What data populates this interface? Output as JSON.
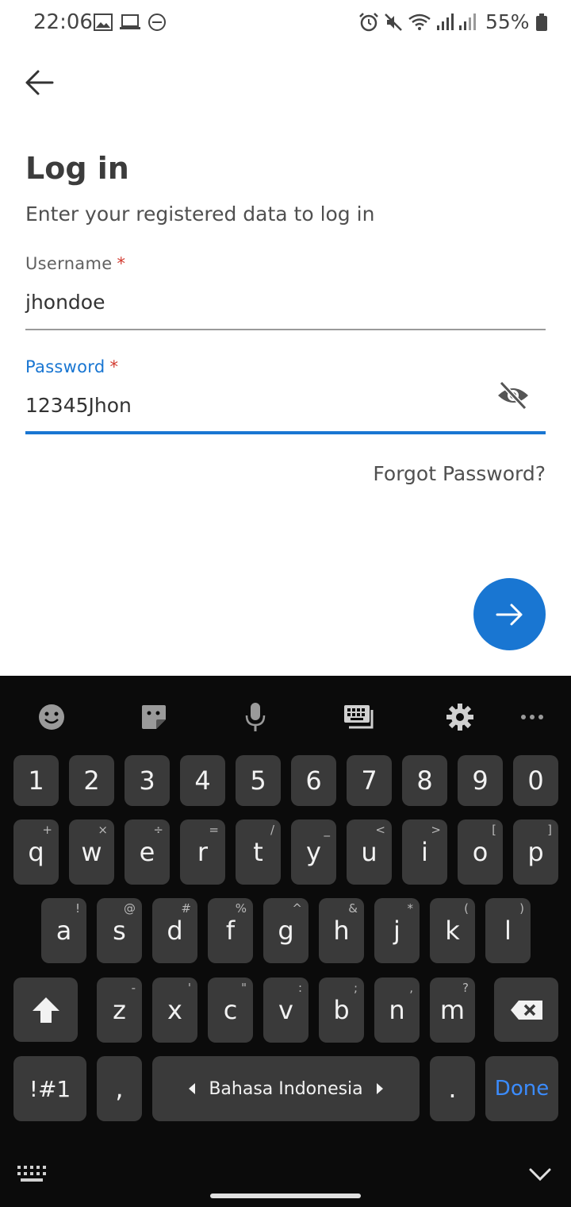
{
  "status": {
    "time": "22:06",
    "battery": "55%"
  },
  "login": {
    "title": "Log in",
    "subtitle": "Enter your registered data to log in",
    "username_label": "Username",
    "username_value": "jhondoe",
    "password_label": "Password",
    "password_value": "12345Jhon",
    "required_mark": "*",
    "forgot": "Forgot Password?"
  },
  "keyboard": {
    "number_row": [
      "1",
      "2",
      "3",
      "4",
      "5",
      "6",
      "7",
      "8",
      "9",
      "0"
    ],
    "row1": [
      {
        "key": "q",
        "hint": "+"
      },
      {
        "key": "w",
        "hint": "×"
      },
      {
        "key": "e",
        "hint": "÷"
      },
      {
        "key": "r",
        "hint": "="
      },
      {
        "key": "t",
        "hint": "/"
      },
      {
        "key": "y",
        "hint": "_"
      },
      {
        "key": "u",
        "hint": "<"
      },
      {
        "key": "i",
        "hint": ">"
      },
      {
        "key": "o",
        "hint": "["
      },
      {
        "key": "p",
        "hint": "]"
      }
    ],
    "row2": [
      {
        "key": "a",
        "hint": "!"
      },
      {
        "key": "s",
        "hint": "@"
      },
      {
        "key": "d",
        "hint": "#"
      },
      {
        "key": "f",
        "hint": "%"
      },
      {
        "key": "g",
        "hint": "^"
      },
      {
        "key": "h",
        "hint": "&"
      },
      {
        "key": "j",
        "hint": "*"
      },
      {
        "key": "k",
        "hint": "("
      },
      {
        "key": "l",
        "hint": ")"
      }
    ],
    "row3": [
      {
        "key": "z",
        "hint": "-"
      },
      {
        "key": "x",
        "hint": "'"
      },
      {
        "key": "c",
        "hint": "\""
      },
      {
        "key": "v",
        "hint": ":"
      },
      {
        "key": "b",
        "hint": ";"
      },
      {
        "key": "n",
        "hint": ","
      },
      {
        "key": "m",
        "hint": "?"
      }
    ],
    "symbols_key": "!#1",
    "comma_key": ",",
    "space_label": "Bahasa Indonesia",
    "period_key": ".",
    "done_key": "Done"
  }
}
